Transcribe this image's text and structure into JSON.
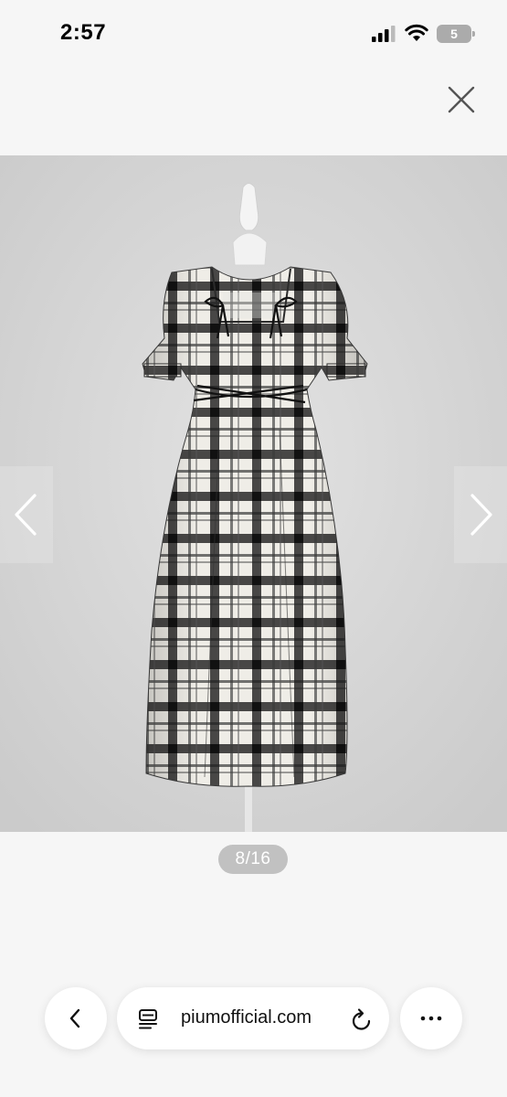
{
  "status_bar": {
    "time": "2:57",
    "battery_level": "5",
    "icons": [
      "cellular-signal-icon",
      "wifi-icon",
      "battery-icon"
    ]
  },
  "viewer": {
    "close_icon": "close-icon",
    "prev_icon": "chevron-left-icon",
    "next_icon": "chevron-right-icon",
    "counter": "8/16",
    "image_description_colors": {
      "plaid_dark": "#1e1e1e",
      "plaid_light": "#f2f0ea",
      "backdrop": "#d8d8d8"
    }
  },
  "toolbar": {
    "back_icon": "chevron-left-icon",
    "page_icon": "page-menu-icon",
    "url": "piumofficial.com",
    "reload_icon": "reload-icon",
    "more_icon": "more-dots-icon"
  }
}
